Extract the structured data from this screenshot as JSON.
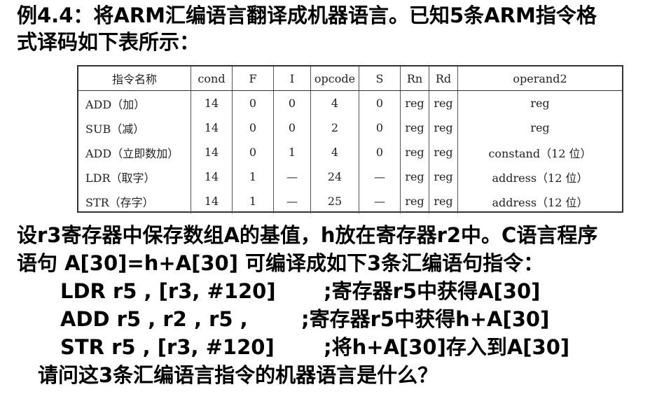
{
  "intro": {
    "line1": "例4.4：将ARM汇编语言翻译成机器语言。已知5条ARM指令格",
    "line2": "式译码如下表所示："
  },
  "table": {
    "headers": [
      "指令名称",
      "cond",
      "F",
      "I",
      "opcode",
      "S",
      "Rn",
      "Rd",
      "operand2"
    ],
    "rows": [
      [
        "ADD（加）",
        "14",
        "0",
        "0",
        "4",
        "0",
        "reg",
        "reg",
        "reg"
      ],
      [
        "SUB（减）",
        "14",
        "0",
        "0",
        "2",
        "0",
        "reg",
        "reg",
        "reg"
      ],
      [
        "ADD（立即数加）",
        "14",
        "0",
        "1",
        "4",
        "0",
        "reg",
        "reg",
        "constand（12 位）"
      ],
      [
        "LDR（取字）",
        "14",
        "1",
        "—",
        "24",
        "—",
        "reg",
        "reg",
        "address（12 位）"
      ],
      [
        "STR（存字）",
        "14",
        "1",
        "—",
        "25",
        "—",
        "reg",
        "reg",
        "address（12 位）"
      ]
    ]
  },
  "body": {
    "line1": "设r3寄存器中保存数组A的基值，h放在寄存器r2中。C语言程序",
    "line2": "语句 A[30]=h+A[30] 可编译成如下3条汇编语句指令："
  },
  "code": [
    {
      "instr": "LDR r5 , [r3, #120]",
      "comment": ";寄存器r5中获得A[30]"
    },
    {
      "instr": "ADD r5 , r2 , r5 ,",
      "comment": ";寄存器r5中获得h+A[30]"
    },
    {
      "instr": "STR r5 , [r3, #120]",
      "comment": ";将h+A[30]存入到A[30]"
    }
  ],
  "question": "请问这3条汇编语言指令的机器语言是什么？"
}
